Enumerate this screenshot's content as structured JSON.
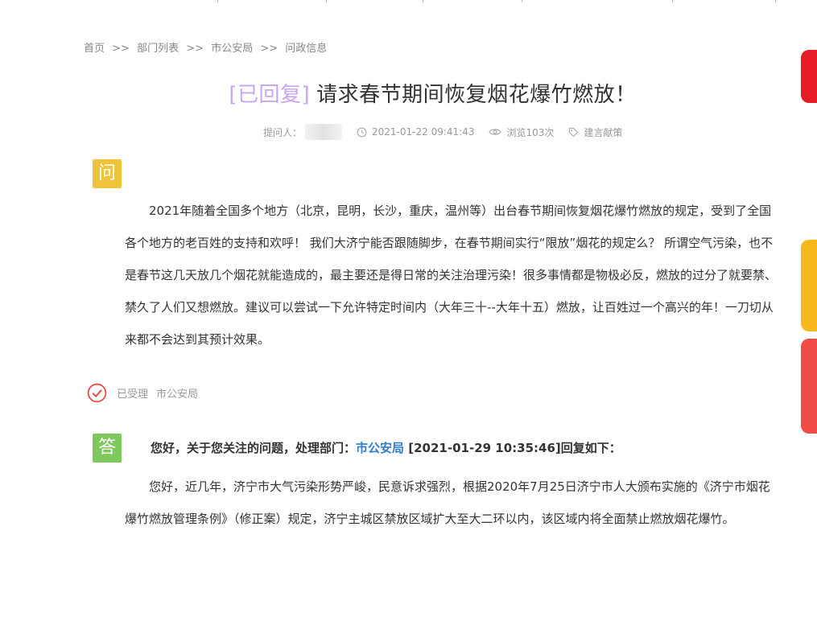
{
  "breadcrumb": {
    "items": [
      "首页",
      "部门列表",
      "市公安局",
      "问政信息"
    ],
    "separator": ">>"
  },
  "post": {
    "status": "[已回复]",
    "title": "请求春节期间恢复烟花爆竹燃放！",
    "asker_label": "提问人：",
    "datetime": "2021-01-22 09:41:43",
    "views": "浏览103次",
    "category": "建言献策"
  },
  "question": {
    "badge": "问",
    "text": "2021年随着全国多个地方（北京，昆明，长沙，重庆，温州等）出台春节期间恢复烟花爆竹燃放的规定，受到了全国各个地方的老百姓的支持和欢呼！ 我们大济宁能否跟随脚步，在春节期间实行“限放”烟花的规定么？ 所谓空气污染，也不是春节这几天放几个烟花就能造成的，最主要还是得日常的关注治理污染！很多事情都是物极必反，燃放的过分了就要禁、禁久了人们又想燃放。建议可以尝试一下允许特定时间内（大年三十--大年十五）燃放，让百姓过一个高兴的年！一刀切从来都不会达到其预计效果。"
  },
  "acceptance": {
    "status": "已受理",
    "department": "市公安局"
  },
  "answer": {
    "badge": "答",
    "head_prefix": "您好，关于您关注的问题，处理部门：",
    "department": "市公安局",
    "head_suffix": "[2021-01-29 10:35:46]回复如下：",
    "text": "您好，近几年，济宁市大气污染形势严峻，民意诉求强烈，根据2020年7月25日济宁市人大颁布实施的《济宁市烟花爆竹燃放管理条例》（修正案）规定，济宁主城区禁放区域扩大至大二环以内，该区域内将全面禁止燃放烟花爆竹。"
  },
  "colors": {
    "status": "#c9a7f0",
    "ask_badge": "#f0c33c",
    "answer_badge": "#7ec95c",
    "department_link": "#2e7dd1",
    "accepted_ring": "#e8453c",
    "side_red": "#e51c23",
    "side_yellow": "#f6b81c"
  },
  "icons": {
    "clock": "clock-icon",
    "eye": "eye-icon",
    "tag": "tag-icon",
    "accepted": "check-circle-icon"
  }
}
